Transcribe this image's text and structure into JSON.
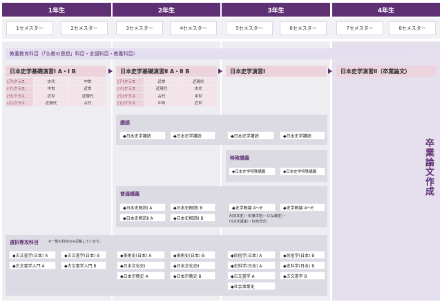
{
  "years": [
    "1年生",
    "2年生",
    "3年生",
    "4年生"
  ],
  "semesters": [
    "1セメスター",
    "2セメスター",
    "3セメスター",
    "4セメスター",
    "5セメスター",
    "6セメスター",
    "7セメスター",
    "8セメスター"
  ],
  "general_education": "教養教育科目（「仏教の思想」科目・言語科目・教養科目）",
  "seminars": [
    "日本史学基礎演習Ⅰ A・Ⅰ B",
    "日本史学基礎演習Ⅱ A・Ⅱ B",
    "日本史学演習Ⅰ",
    "日本史学演習Ⅱ（卒業論文）"
  ],
  "classes_y1": [
    [
      "(ア)クラス",
      "古代",
      "中世"
    ],
    [
      "(イ)クラス",
      "中世",
      "近世"
    ],
    [
      "(ウ)クラス",
      "近世",
      "近現代"
    ],
    [
      "(エ)クラス",
      "近現代",
      "古代"
    ]
  ],
  "classes_y2": [
    [
      "(ア)クラス",
      "近世",
      "近現代"
    ],
    [
      "(イ)クラス",
      "近現代",
      "古代"
    ],
    [
      "(ウ)クラス",
      "古代",
      "中世"
    ],
    [
      "(エ)クラス",
      "中世",
      "近世"
    ]
  ],
  "lecture": {
    "title": "講読",
    "items": [
      "◆日本史学講読",
      "◆日本史学講読",
      "◆日本史学講読",
      "◆日本史学講読"
    ]
  },
  "special": {
    "title": "特殊講義",
    "items": [
      "◆日本史学特殊講義",
      "◆日本史学特殊講義"
    ]
  },
  "general_lecture": {
    "title": "普通講義",
    "y2": [
      "◆日本史概説Ⅰ A",
      "◆日本史概説Ⅰ B",
      "◆日本史概説Ⅱ A",
      "◆日本史概説Ⅱ B"
    ],
    "y3": [
      "◆史学概論 A～E",
      "◆史学概論 A～E"
    ],
    "note1": "A(日本史)・B(東洋史)・C(仏教史)・",
    "note2": "D(文化遺産)・E(西洋史)"
  },
  "elective": {
    "title": "選択専攻科目",
    "note": "※一部の科目のみ記載しています。",
    "y1": [
      "◆古文書学(日本) A",
      "◆古文書学(日本) B",
      "◆古文書学入門 A",
      "◆古文書学入門 B"
    ],
    "y2": [
      "◆美術史(日本) A",
      "◆美術史(日本) B",
      "◆日本文化史Ⅰ",
      "◆日本文化史Ⅱ",
      "◆日本宗教史 A",
      "◆日本宗教史 B"
    ],
    "y3": [
      "◆民俗学(日本) A",
      "◆民俗学(日本) B",
      "◆史料学(日本) A",
      "◆史料学(日本) B",
      "◆古文書学 A",
      "◆古文書学 B",
      "◆社会事業史"
    ]
  },
  "thesis": "卒業論文作成"
}
